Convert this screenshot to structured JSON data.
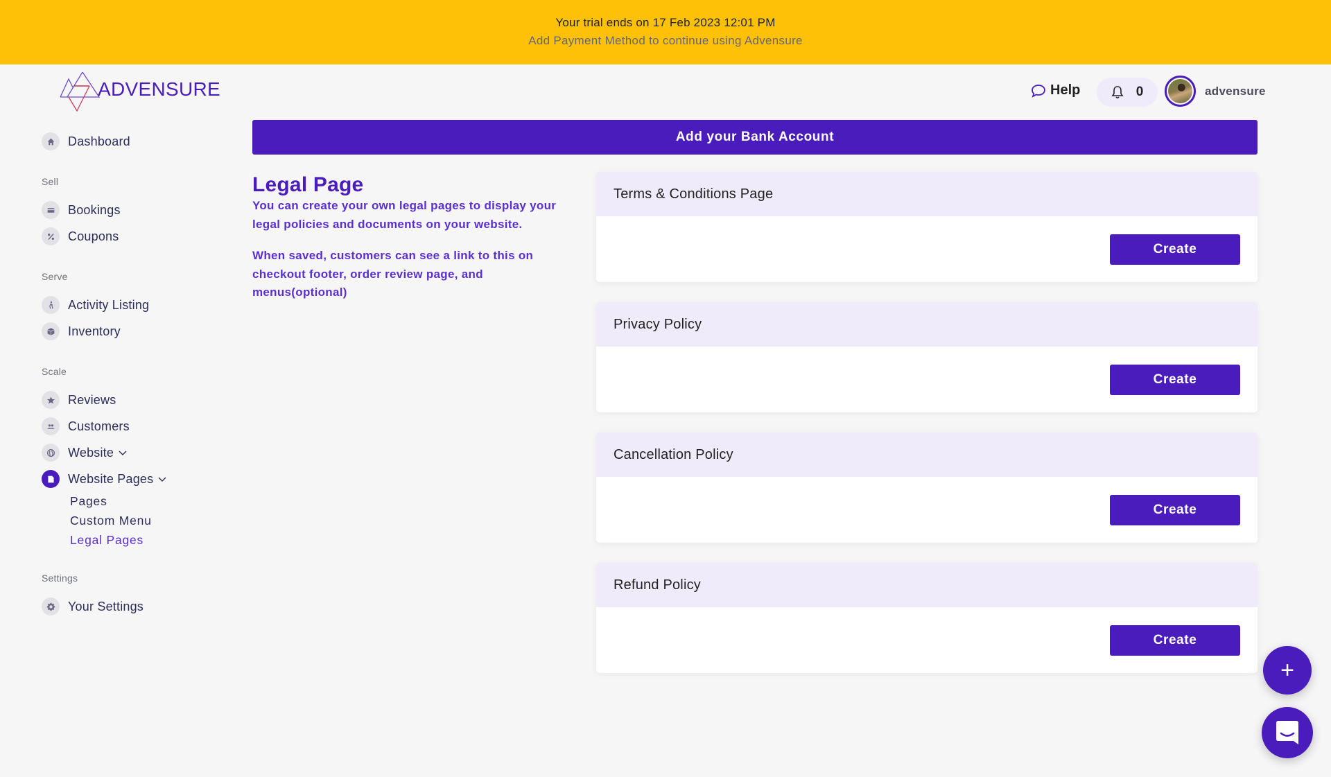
{
  "banner": {
    "line1": "Your trial ends on 17 Feb 2023 12:01 PM",
    "line2": "Add Payment Method to continue using Advensure",
    "background": "#FFC107"
  },
  "logo": {
    "brand": "ADVENSURE"
  },
  "topbar": {
    "help_label": "Help",
    "notification_count": "0",
    "username": "advensure"
  },
  "sidebar": {
    "dashboard": {
      "label": "Dashboard",
      "icon": "home-icon"
    },
    "sections": [
      {
        "title": "Sell",
        "items": [
          {
            "label": "Bookings",
            "icon": "card-icon"
          },
          {
            "label": "Coupons",
            "icon": "percent-icon"
          }
        ]
      },
      {
        "title": "Serve",
        "items": [
          {
            "label": "Activity Listing",
            "icon": "hiking-icon"
          },
          {
            "label": "Inventory",
            "icon": "box-icon"
          }
        ]
      },
      {
        "title": "Scale",
        "items": [
          {
            "label": "Reviews",
            "icon": "star-icon"
          },
          {
            "label": "Customers",
            "icon": "people-icon"
          },
          {
            "label": "Website",
            "icon": "globe-icon",
            "expandable": true
          },
          {
            "label": "Website Pages",
            "icon": "page-icon",
            "expandable": true,
            "active": true,
            "children": [
              {
                "label": "Pages"
              },
              {
                "label": "Custom Menu"
              },
              {
                "label": "Legal Pages",
                "active": true
              }
            ]
          }
        ]
      },
      {
        "title": "Settings",
        "items": [
          {
            "label": "Your Settings",
            "icon": "gear-icon"
          }
        ]
      }
    ]
  },
  "main": {
    "bank_bar_label": "Add your Bank Account",
    "title": "Legal Page",
    "description1": "You can create your own legal pages to display your legal policies and documents on your website.",
    "description2": "When saved, customers can see a link to this on checkout footer, order review page, and menus(optional)",
    "cards": [
      {
        "title": "Terms & Conditions Page",
        "button": "Create"
      },
      {
        "title": "Privacy Policy",
        "button": "Create"
      },
      {
        "title": "Cancellation Policy",
        "button": "Create"
      },
      {
        "title": "Refund Policy",
        "button": "Create"
      }
    ]
  },
  "fab": {
    "plus_label": "+"
  },
  "colors": {
    "accent": "#4a1cbb",
    "card_header": "#efebfa",
    "banner": "#FFC107"
  }
}
